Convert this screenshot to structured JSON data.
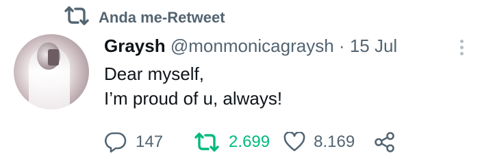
{
  "retweet_banner": {
    "icon": "retweet-icon",
    "label": "Anda me-Retweet"
  },
  "tweet": {
    "avatar": "avatar-photo",
    "author_name": "Graysh",
    "handle": "@monmonicagraysh",
    "separator": "·",
    "date": "15 Jul",
    "more_icon": "more-vertical-icon",
    "text_lines": [
      "Dear myself,",
      "I’m proud of u, always!"
    ]
  },
  "actions": {
    "reply": {
      "icon": "reply-icon",
      "count": "147"
    },
    "retweet": {
      "icon": "retweet-icon",
      "count": "2.699",
      "active": true,
      "color": "#00ba7c"
    },
    "like": {
      "icon": "heart-icon",
      "count": "8.169"
    },
    "share": {
      "icon": "share-icon"
    }
  },
  "colors": {
    "text": "#0f1419",
    "muted": "#536471",
    "retweet_green": "#00ba7c"
  }
}
